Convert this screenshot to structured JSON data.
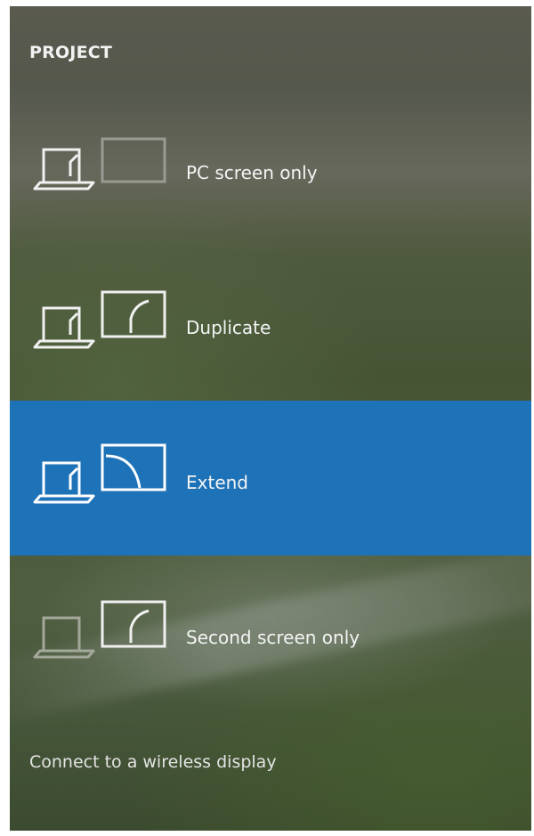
{
  "header": {
    "title": "PROJECT"
  },
  "options": [
    {
      "label": "PC screen only",
      "icon": "pc-screen-only-icon",
      "selected": false
    },
    {
      "label": "Duplicate",
      "icon": "duplicate-icon",
      "selected": false
    },
    {
      "label": "Extend",
      "icon": "extend-icon",
      "selected": true
    },
    {
      "label": "Second screen only",
      "icon": "second-screen-only-icon",
      "selected": false
    }
  ],
  "footer": {
    "link": "Connect to a wireless display"
  },
  "colors": {
    "selected": "#1e72b8",
    "text": "#f4f4f4"
  }
}
